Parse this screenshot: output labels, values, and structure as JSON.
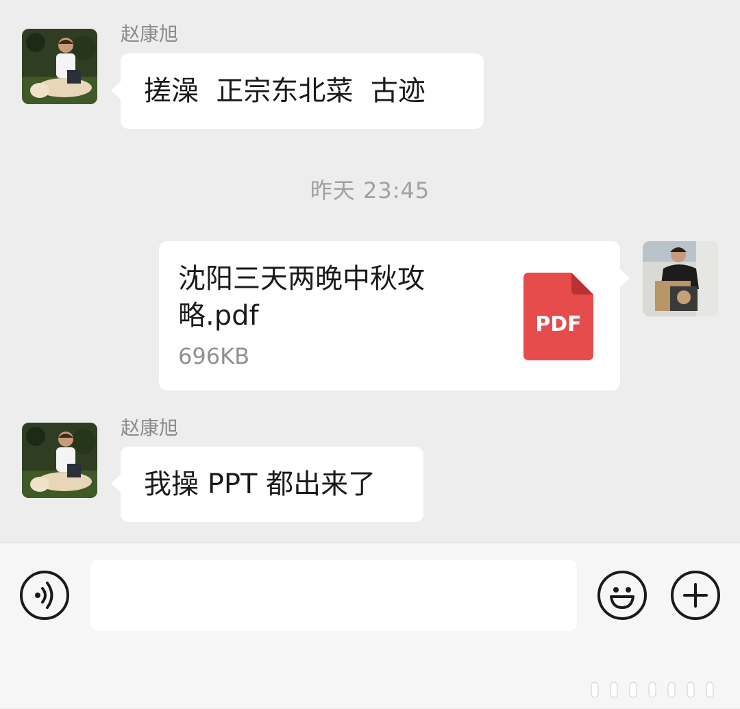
{
  "messages": [
    {
      "type": "text",
      "side": "left",
      "sender": "赵康旭",
      "text": "搓澡  正宗东北菜  古迹"
    },
    {
      "type": "timestamp",
      "text": "昨天 23:45"
    },
    {
      "type": "file",
      "side": "right",
      "file_name": "沈阳三天两晚中秋攻略.pdf",
      "file_size": "696KB",
      "file_icon": "pdf-icon",
      "file_icon_label": "PDF",
      "file_icon_color": "#e64c4c"
    },
    {
      "type": "text",
      "side": "left",
      "sender": "赵康旭",
      "text": "我操 PPT 都出来了"
    }
  ],
  "input_bar": {
    "voice_icon": "voice-icon",
    "input_value": "",
    "emoji_icon": "emoji-icon",
    "plus_icon": "plus-icon"
  },
  "colors": {
    "chat_background": "#ededed",
    "bubble": "#ffffff",
    "input_bar": "#f6f6f6"
  }
}
